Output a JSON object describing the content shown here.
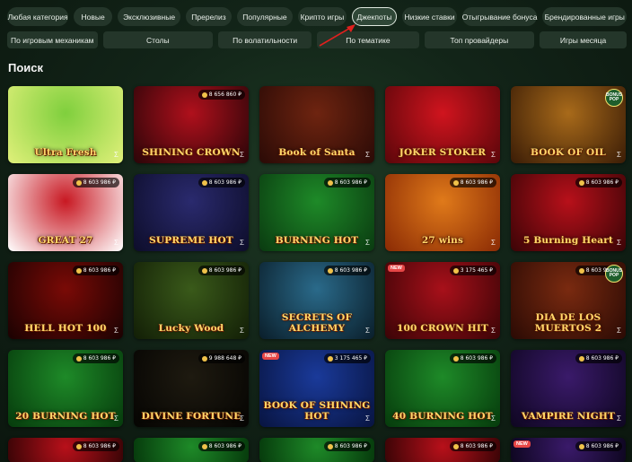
{
  "filters": {
    "row1": [
      "Любая категория",
      "Новые",
      "Эксклюзивные",
      "Пререлиз",
      "Популярные",
      "Крипто игры",
      "Джекпоты",
      "Низкие ставки",
      "Отыгрывание бонуса",
      "Брендированные игры"
    ],
    "row2": [
      "По игровым механикам",
      "Столы",
      "По волатильности",
      "По тематике",
      "Топ провайдеры",
      "Игры месяца"
    ],
    "active": "Джекпоты"
  },
  "section_title": "Поиск",
  "games": [
    {
      "title": "Ultra Fresh",
      "jackpot": "",
      "bg": "#7fcf3d",
      "bg2": "#e0f07a",
      "tag": "",
      "pop": false
    },
    {
      "title": "SHINING CROWN",
      "jackpot": "8 656 860 ₽",
      "bg": "#b0101c",
      "bg2": "#2a0508",
      "tag": "",
      "pop": false
    },
    {
      "title": "Book of Santa",
      "jackpot": "",
      "bg": "#6e2410",
      "bg2": "#2a0a06",
      "tag": "",
      "pop": false
    },
    {
      "title": "JOKER STOKER",
      "jackpot": "",
      "bg": "#d0141e",
      "bg2": "#5a060a",
      "tag": "",
      "pop": false
    },
    {
      "title": "BOOK OF OIL",
      "jackpot": "",
      "bg": "#a86a1a",
      "bg2": "#3a1c06",
      "tag": "",
      "pop": true
    },
    {
      "title": "GREAT 27",
      "jackpot": "8 603 986 ₽",
      "bg": "#c81822",
      "bg2": "#ffffff",
      "tag": "",
      "pop": false
    },
    {
      "title": "SUPREME HOT",
      "jackpot": "8 603 986 ₽",
      "bg": "#2a2a6e",
      "bg2": "#0d0d2a",
      "tag": "",
      "pop": false
    },
    {
      "title": "BURNING HOT",
      "jackpot": "8 603 986 ₽",
      "bg": "#1e8a28",
      "bg2": "#0a3a10",
      "tag": "",
      "pop": false
    },
    {
      "title": "27 wins",
      "jackpot": "8 603 986 ₽",
      "bg": "#e07a1a",
      "bg2": "#8a2a04",
      "tag": "",
      "pop": false
    },
    {
      "title": "5 Burning Heart",
      "jackpot": "8 603 986 ₽",
      "bg": "#b8101a",
      "bg2": "#3a0406",
      "tag": "",
      "pop": false
    },
    {
      "title": "HELL HOT 100",
      "jackpot": "8 603 986 ₽",
      "bg": "#7a0a06",
      "bg2": "#1a0202",
      "tag": "",
      "pop": false
    },
    {
      "title": "Lucky Wood",
      "jackpot": "8 603 986 ₽",
      "bg": "#3a5a1a",
      "bg2": "#121e06",
      "tag": "",
      "pop": false
    },
    {
      "title": "SECRETS OF ALCHEMY",
      "jackpot": "8 603 986 ₽",
      "bg": "#2a6a8a",
      "bg2": "#0a1e2a",
      "tag": "",
      "pop": false
    },
    {
      "title": "100 CROWN HIT",
      "jackpot": "3 175 465 ₽",
      "bg": "#a8101a",
      "bg2": "#3a0406",
      "tag": "NEW",
      "pop": false
    },
    {
      "title": "DIA DE LOS MUERTOS 2",
      "jackpot": "8 603 986 ₽",
      "bg": "#7a2a10",
      "bg2": "#2a0a04",
      "tag": "",
      "pop": true
    },
    {
      "title": "20 BURNING HOT",
      "jackpot": "8 603 986 ₽",
      "bg": "#1e8a28",
      "bg2": "#063a0c",
      "tag": "",
      "pop": false
    },
    {
      "title": "DIVINE FORTUNE",
      "jackpot": "9 988 648 ₽",
      "bg": "#1e1a10",
      "bg2": "#050402",
      "tag": "",
      "pop": false
    },
    {
      "title": "BOOK OF SHINING HOT",
      "jackpot": "3 175 465 ₽",
      "bg": "#1a3a9a",
      "bg2": "#081440",
      "tag": "NEW",
      "pop": false
    },
    {
      "title": "40 BURNING HOT",
      "jackpot": "8 603 986 ₽",
      "bg": "#1e8a28",
      "bg2": "#063a0c",
      "tag": "",
      "pop": false
    },
    {
      "title": "VAMPIRE NIGHT",
      "jackpot": "8 603 986 ₽",
      "bg": "#3a1a6a",
      "bg2": "#0e0620",
      "tag": "",
      "pop": false
    },
    {
      "title": "",
      "jackpot": "8 603 986 ₽",
      "bg": "#b8101a",
      "bg2": "#3a0406",
      "tag": "",
      "pop": false
    },
    {
      "title": "",
      "jackpot": "8 603 986 ₽",
      "bg": "#1e8a28",
      "bg2": "#063a0c",
      "tag": "",
      "pop": false
    },
    {
      "title": "",
      "jackpot": "8 603 986 ₽",
      "bg": "#1e8a28",
      "bg2": "#063a0c",
      "tag": "",
      "pop": false
    },
    {
      "title": "",
      "jackpot": "8 603 986 ₽",
      "bg": "#b8101a",
      "bg2": "#3a0406",
      "tag": "",
      "pop": false
    },
    {
      "title": "",
      "jackpot": "8 603 986 ₽",
      "bg": "#3a1a6a",
      "bg2": "#0e0620",
      "tag": "NEW",
      "pop": false
    }
  ],
  "pop_label": "BONUS POP",
  "provider_symbol": "Σ",
  "colors": {
    "accent": "#f0c24a",
    "chip": "#24362a",
    "bg": "#122418"
  },
  "arrow_color": "#e0201e"
}
